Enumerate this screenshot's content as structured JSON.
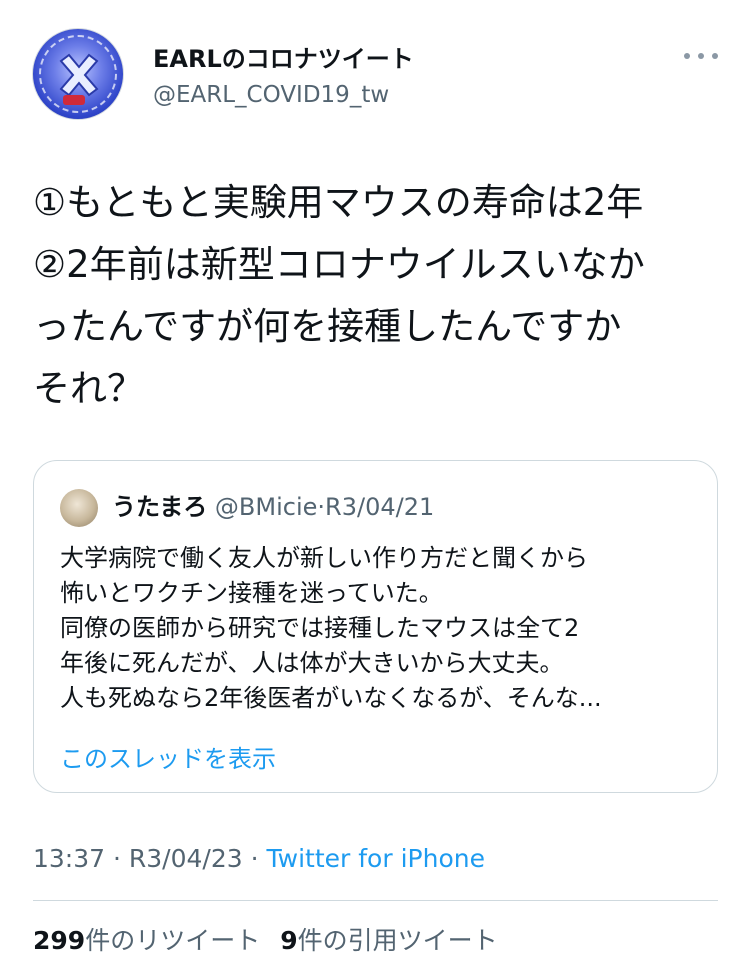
{
  "author": {
    "display_name": "EARLのコロナツイート",
    "handle": "@EARL_COVID19_tw",
    "avatar_icon": "profile-avatar"
  },
  "more_icon": "more-horizontal-icon",
  "tweet": {
    "text": "①もともと実験用マウスの寿命は2年\n②2年前は新型コロナウイルスいなか\nったんですが何を接種したんですか\nそれ？"
  },
  "quote": {
    "name": "うたまろ",
    "handle": "@BMicie",
    "separator": "·",
    "date": "R3/04/21",
    "text": "大学病院で働く友人が新しい作り方だと聞くから\n怖いとワクチン接種を迷っていた。\n同僚の医師から研究では接種したマウスは全て2\n年後に死んだが、人は体が大きいから大丈夫。\n人も死ぬなら2年後医者がいなくなるが、そんな...",
    "show_thread": "このスレッドを表示"
  },
  "meta": {
    "time": "13:37",
    "separator": "·",
    "date": "R3/04/23",
    "source": "Twitter for iPhone"
  },
  "stats": {
    "retweets_count": "299",
    "retweets_label": "件のリツイート",
    "quotes_count": "9",
    "quotes_label": "件の引用ツイート"
  },
  "colors": {
    "link": "#1d9bf0",
    "secondary_text": "#536471",
    "border": "#cfd9de"
  }
}
